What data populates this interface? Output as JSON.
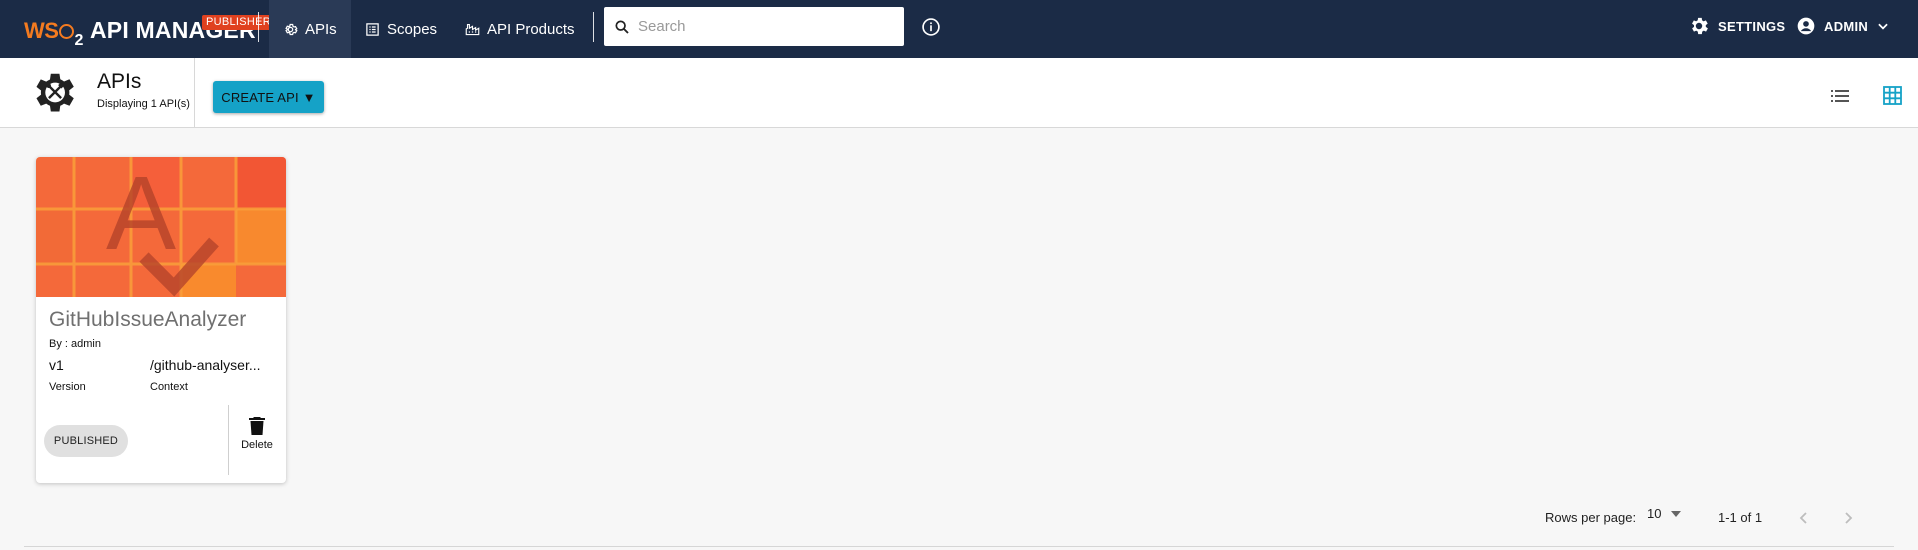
{
  "brand": {
    "logo_text": "WSO2",
    "product": "API MANAGER",
    "badge": "PUBLISHER"
  },
  "nav": [
    {
      "label": "APIs",
      "icon": "gear-icon",
      "active": true
    },
    {
      "label": "Scopes",
      "icon": "scopes-list-icon",
      "active": false
    },
    {
      "label": "API Products",
      "icon": "api-products-icon",
      "active": false
    }
  ],
  "search": {
    "placeholder": "Search",
    "value": ""
  },
  "header_right": {
    "settings_label": "SETTINGS",
    "user_label": "ADMIN"
  },
  "page": {
    "title": "APIs",
    "subtitle": "Displaying 1 API(s)",
    "create_button": "CREATE API ▼"
  },
  "views": {
    "list_icon": "list-view-icon",
    "grid_icon": "grid-view-icon",
    "active": "grid"
  },
  "apis": [
    {
      "name": "GitHubIssueAnalyzer",
      "by": "By : admin",
      "version": "v1",
      "version_label": "Version",
      "context": "/github-analyser...",
      "context_label": "Context",
      "status": "PUBLISHED",
      "delete_label": "Delete",
      "thumbnail_letter": "A"
    }
  ],
  "pagination": {
    "rows_label": "Rows per page:",
    "rows_value": "10",
    "range": "1-1 of 1"
  },
  "colors": {
    "appbar": "#1b2b46",
    "accent": "#15a2c7",
    "brand_orange": "#f47b20",
    "badge": "#e0411f"
  }
}
